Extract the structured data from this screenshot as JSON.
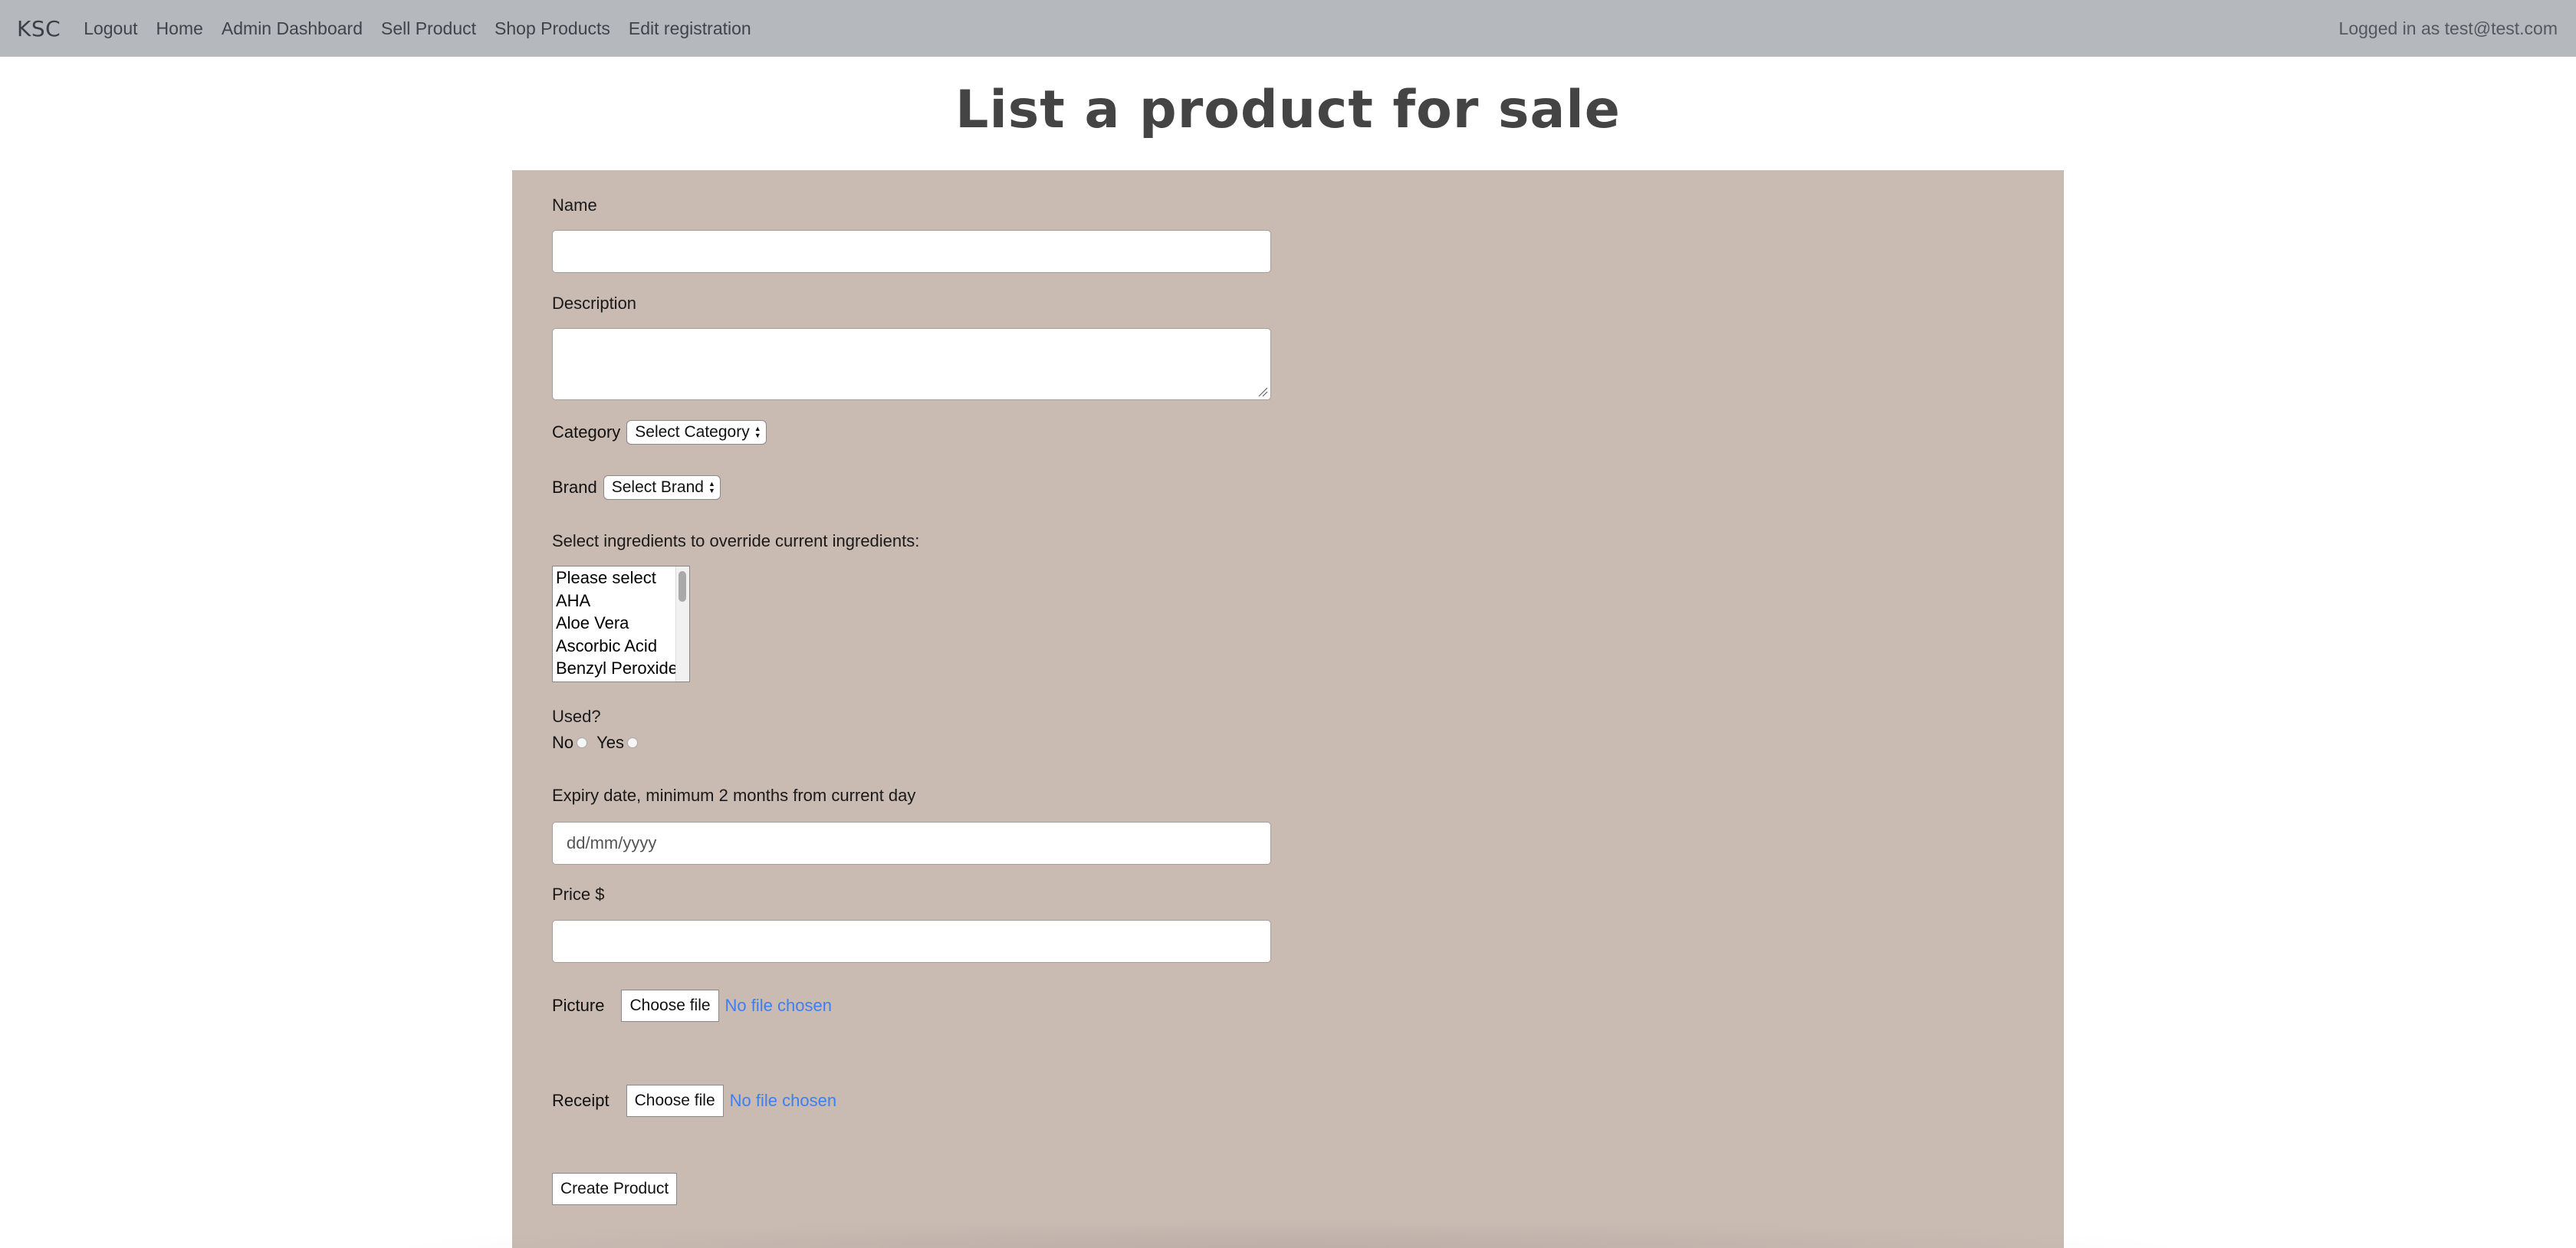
{
  "navbar": {
    "brand": "KSC",
    "links": [
      "Logout",
      "Home",
      "Admin Dashboard",
      "Sell Product",
      "Shop Products",
      "Edit registration"
    ],
    "user_status": "Logged in as test@test.com"
  },
  "page": {
    "title": "List a product for sale"
  },
  "form": {
    "name_label": "Name",
    "description_label": "Description",
    "category_label": "Category",
    "category_selected": "Select Category",
    "brand_label": "Brand",
    "brand_selected": "Select Brand",
    "ingredients_label": "Select ingredients to override current ingredients:",
    "ingredients_options": [
      "Please select",
      "AHA",
      "Aloe Vera",
      "Ascorbic Acid",
      "Benzyl Peroxide"
    ],
    "used_label": "Used?",
    "used_no": "No",
    "used_yes": "Yes",
    "expiry_label": "Expiry date, minimum 2 months from current day",
    "expiry_placeholder": "dd/mm/yyyy",
    "price_label": "Price $",
    "picture_label": "Picture",
    "picture_button": "Choose file",
    "picture_status": "No file chosen",
    "receipt_label": "Receipt",
    "receipt_button": "Choose file",
    "receipt_status": "No file chosen",
    "submit_label": "Create Product"
  },
  "colors": {
    "navbar_bg": "#b5b8bd",
    "panel_bg": "#c9bab2",
    "title_color": "#444444",
    "link_blue": "#3d7ff0"
  }
}
